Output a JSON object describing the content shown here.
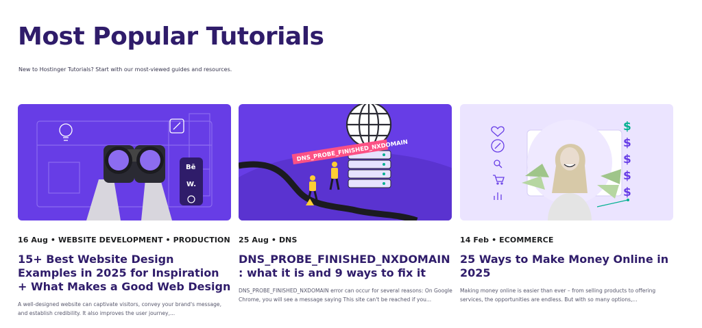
{
  "header": {
    "title": "Most Popular Tutorials",
    "subtitle": "New to Hostinger Tutorials? Start with our most-viewed guides and resources."
  },
  "cards": [
    {
      "meta": "16 Aug • WEBSITE DEVELOPMENT • PRODUCTION",
      "title": "15+ Best Website Design Examples in 2025 for Inspiration + What Makes a Good Web Design",
      "excerpt": "A well-designed website can captivate visitors, convey your brand's message, and establish credibility. It also improves the user journey,...",
      "image_icons": [
        "binoculars-icon",
        "lightbulb-icon",
        "pencil-icon",
        "behance-icon",
        "webflow-icon",
        "dribbble-icon"
      ],
      "image_text": {
        "behance": "Bē",
        "webflow": "W."
      },
      "bg_color": "#673de6"
    },
    {
      "meta": "25 Aug • DNS",
      "title": "DNS_PROBE_FINISHED_NXDOMAIN : what it is and 9 ways to fix it",
      "excerpt": "DNS_PROBE_FINISHED_NXDOMAIN error can occur for several reasons: On Google Chrome, you will see a message saying This site can't be reached if you...",
      "image_icons": [
        "globe-icon",
        "server-icon",
        "worker-icon",
        "warning-icon"
      ],
      "image_text": {
        "banner": "DNS_PROBE_FINISHED_NXDOMAIN"
      },
      "bg_color": "#673de6"
    },
    {
      "meta": "14 Feb • ECOMMERCE",
      "title": "25 Ways to Make Money Online in 2025",
      "excerpt": "Making money online is easier than ever – from selling products to offering services, the opportunities are endless. But with so many options,...",
      "image_icons": [
        "heart-icon",
        "edit-icon",
        "search-icon",
        "cart-icon",
        "bar-chart-icon",
        "dollar-icon"
      ],
      "image_text": {
        "dollar": "$"
      },
      "bg_color": "#ebe4ff"
    }
  ]
}
